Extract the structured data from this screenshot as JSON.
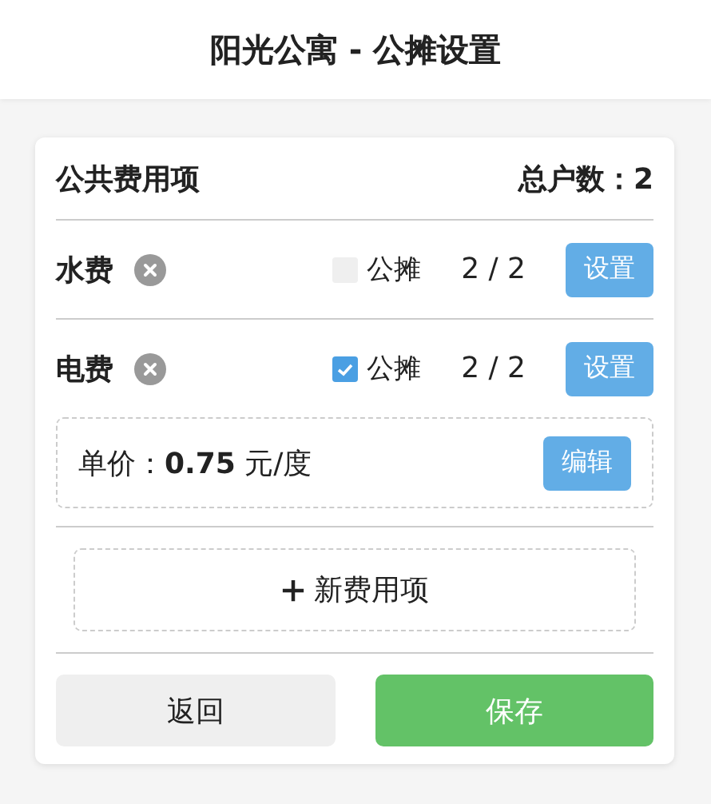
{
  "header": {
    "title": "阳光公寓 - 公摊设置"
  },
  "card": {
    "title": "公共费用项",
    "household_count": "总户数：2",
    "fees": [
      {
        "name": "水费",
        "shared": false,
        "shared_label": "公摊",
        "count": "2 / 2",
        "button": "设置"
      },
      {
        "name": "电费",
        "shared": true,
        "shared_label": "公摊",
        "count": "2 / 2",
        "button": "设置",
        "price": {
          "text": "单价：**0.75** 元/度",
          "button": "编辑"
        }
      }
    ],
    "add_button": "新费用项",
    "buttons": [
      {
        "label": "返回",
        "kind": "secondary"
      },
      {
        "label": "保存",
        "kind": "primary"
      }
    ]
  }
}
